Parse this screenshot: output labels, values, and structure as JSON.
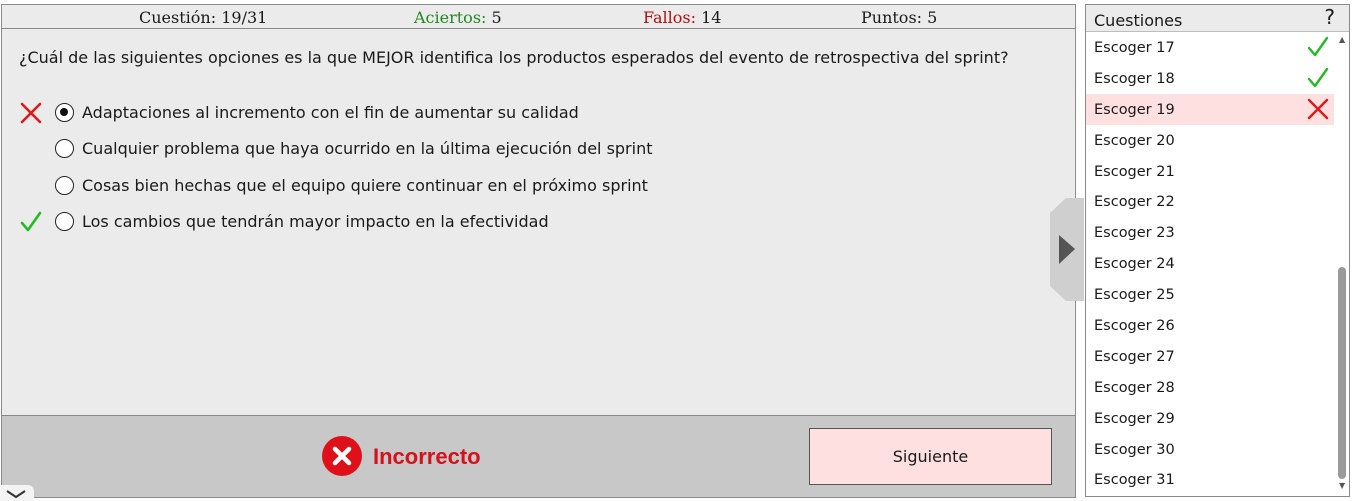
{
  "stats": {
    "question_label": "Cuestión:",
    "question_value": "19/31",
    "correct_label": "Aciertos:",
    "correct_value": "5",
    "wrong_label": "Fallos:",
    "wrong_value": "14",
    "points_label": "Puntos:",
    "points_value": "5"
  },
  "question": "¿Cuál de las siguientes opciones es la que MEJOR identifica los productos esperados del evento de retrospectiva del sprint?",
  "options": [
    {
      "text": "Adaptaciones al incremento con el fin de aumentar su calidad",
      "selected": true,
      "mark": "wrong-icon"
    },
    {
      "text": "Cualquier problema que haya ocurrido en la última ejecución del sprint",
      "selected": false,
      "mark": ""
    },
    {
      "text": "Cosas bien hechas que el equipo quiere continuar en el próximo sprint",
      "selected": false,
      "mark": ""
    },
    {
      "text": "Los cambios que tendrán mayor impacto en la efectividad",
      "selected": false,
      "mark": "check-icon"
    }
  ],
  "result": {
    "text": "Incorrecto",
    "icon": "error-circle-icon"
  },
  "next_button": "Siguiente",
  "sidebar": {
    "title": "Cuestiones",
    "help": "?",
    "items": [
      {
        "label": "Escoger 17",
        "status": "correct"
      },
      {
        "label": "Escoger 18",
        "status": "correct"
      },
      {
        "label": "Escoger 19",
        "status": "wrong",
        "current": true
      },
      {
        "label": "Escoger 20",
        "status": ""
      },
      {
        "label": "Escoger 21",
        "status": ""
      },
      {
        "label": "Escoger 22",
        "status": ""
      },
      {
        "label": "Escoger 23",
        "status": ""
      },
      {
        "label": "Escoger 24",
        "status": ""
      },
      {
        "label": "Escoger 25",
        "status": ""
      },
      {
        "label": "Escoger 26",
        "status": ""
      },
      {
        "label": "Escoger 27",
        "status": ""
      },
      {
        "label": "Escoger 28",
        "status": ""
      },
      {
        "label": "Escoger 29",
        "status": ""
      },
      {
        "label": "Escoger 30",
        "status": ""
      },
      {
        "label": "Escoger 31",
        "status": ""
      }
    ]
  },
  "colors": {
    "correct": "#22bb22",
    "wrong": "#e01818",
    "current_bg": "#ffe0e0",
    "panel_bg": "#ebebeb"
  }
}
